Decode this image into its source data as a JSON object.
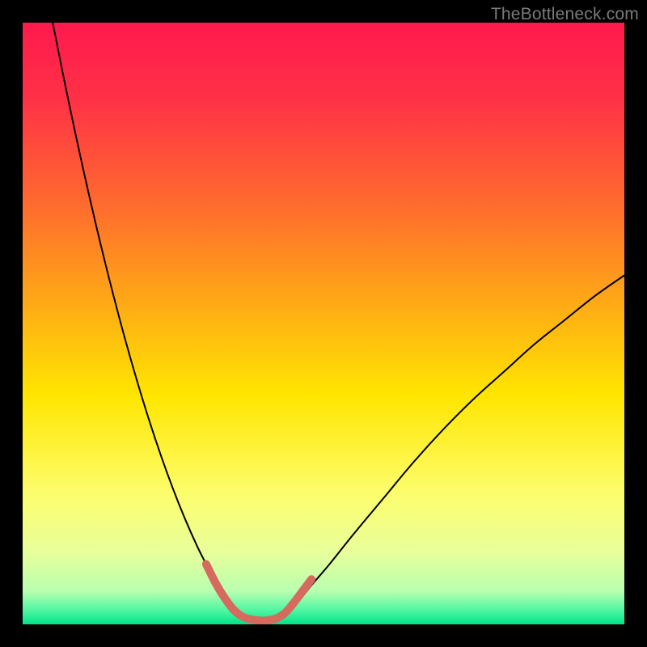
{
  "watermark": "TheBottleneck.com",
  "chart_data": {
    "type": "line",
    "title": "",
    "xlabel": "",
    "ylabel": "",
    "xlim": [
      0,
      100
    ],
    "ylim": [
      0,
      100
    ],
    "background_gradient_stops": [
      {
        "pos": 0.0,
        "color": "#ff1a4d"
      },
      {
        "pos": 0.12,
        "color": "#ff2f47"
      },
      {
        "pos": 0.3,
        "color": "#ff6a2e"
      },
      {
        "pos": 0.45,
        "color": "#ffa318"
      },
      {
        "pos": 0.62,
        "color": "#ffe600"
      },
      {
        "pos": 0.78,
        "color": "#fdfd6b"
      },
      {
        "pos": 0.88,
        "color": "#e8ff9a"
      },
      {
        "pos": 0.945,
        "color": "#b8ffb0"
      },
      {
        "pos": 0.975,
        "color": "#55f7a3"
      },
      {
        "pos": 1.0,
        "color": "#00e58a"
      }
    ],
    "series": [
      {
        "name": "left-branch",
        "color": "#000000",
        "width": 2,
        "x": [
          5.0,
          7.0,
          9.0,
          11.0,
          13.0,
          15.0,
          17.0,
          19.0,
          21.0,
          23.0,
          25.0,
          27.0,
          29.0,
          30.5,
          32.0,
          33.5,
          35.0
        ],
        "y": [
          100.0,
          90.0,
          80.5,
          71.5,
          63.0,
          55.0,
          47.5,
          40.5,
          34.0,
          28.0,
          22.5,
          17.5,
          13.0,
          10.0,
          7.0,
          4.5,
          2.5
        ]
      },
      {
        "name": "right-branch",
        "color": "#000000",
        "width": 2,
        "x": [
          44.5,
          46.0,
          48.0,
          51.0,
          55.0,
          60.0,
          65.0,
          70.0,
          75.0,
          80.0,
          85.0,
          90.0,
          95.0,
          100.0
        ],
        "y": [
          2.5,
          4.0,
          6.5,
          10.0,
          15.0,
          21.0,
          27.0,
          32.5,
          37.5,
          42.0,
          46.5,
          50.5,
          54.5,
          58.0
        ]
      },
      {
        "name": "valley-floor",
        "color": "#000000",
        "width": 2,
        "x": [
          35.0,
          37.0,
          39.0,
          41.0,
          43.0,
          44.5
        ],
        "y": [
          2.5,
          1.0,
          0.6,
          0.6,
          1.2,
          2.5
        ]
      },
      {
        "name": "valley-highlight-left",
        "color": "#d66a5f",
        "width": 10,
        "x": [
          30.5,
          32.0,
          33.5,
          35.0,
          36.5,
          38.0
        ],
        "y": [
          10.0,
          7.0,
          4.5,
          2.5,
          1.3,
          0.8
        ]
      },
      {
        "name": "valley-highlight-floor",
        "color": "#d66a5f",
        "width": 10,
        "x": [
          38.0,
          40.0,
          42.0
        ],
        "y": [
          0.8,
          0.6,
          0.9
        ]
      },
      {
        "name": "valley-highlight-right",
        "color": "#d66a5f",
        "width": 10,
        "x": [
          42.0,
          43.5,
          45.0,
          46.5,
          48.0
        ],
        "y": [
          0.9,
          1.8,
          3.5,
          5.5,
          7.5
        ]
      }
    ]
  }
}
